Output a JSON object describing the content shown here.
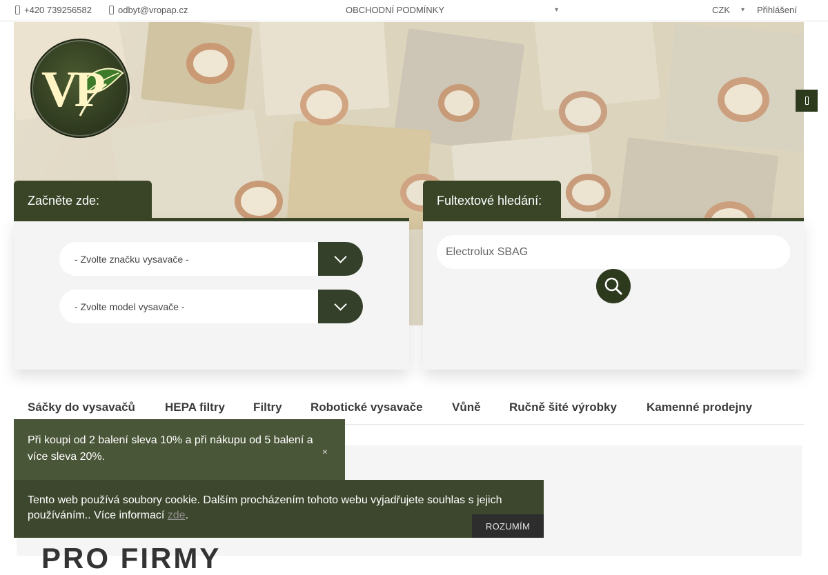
{
  "topbar": {
    "phone": "+420 739256582",
    "email": "odbyt@vropap.cz",
    "terms": "OBCHODNÍ PODMÍNKY",
    "currency": "CZK",
    "login": "Přihlášení"
  },
  "brand": {
    "logo_letters": "VP",
    "logo_color": "#2f3a1f"
  },
  "start_panel": {
    "title": "Začněte zde:",
    "brand_select": "- Zvolte značku vysavače -",
    "model_select": "- Zvolte model vysavače -"
  },
  "search_panel": {
    "title": "Fultextové hledání:",
    "placeholder": "Electrolux SBAG"
  },
  "nav": {
    "items": [
      "Sáčky do vysavačů",
      "HEPA filtry",
      "Filtry",
      "Robotické vysavače",
      "Vůně",
      "Ručně šité výrobky",
      "Kamenné prodejny"
    ]
  },
  "promo": {
    "text": "Při koupi od 2 balení sleva 10% a při nákupu od 5 balení a více sleva 20%."
  },
  "cookie": {
    "text": "Tento web používá soubory cookie. Dalším procházením tohoto webu vyjadřujete souhlas s jejich používáním.. Více informací",
    "link": "zde",
    "suffix": ".",
    "button": "ROZUMÍM"
  },
  "content": {
    "heading": "PRO FIRMY"
  },
  "colors": {
    "accent": "#3a4528",
    "dark_button": "#2e3a1e",
    "promo_bg": "#4a5638",
    "cookie_bg": "#3d472d"
  }
}
